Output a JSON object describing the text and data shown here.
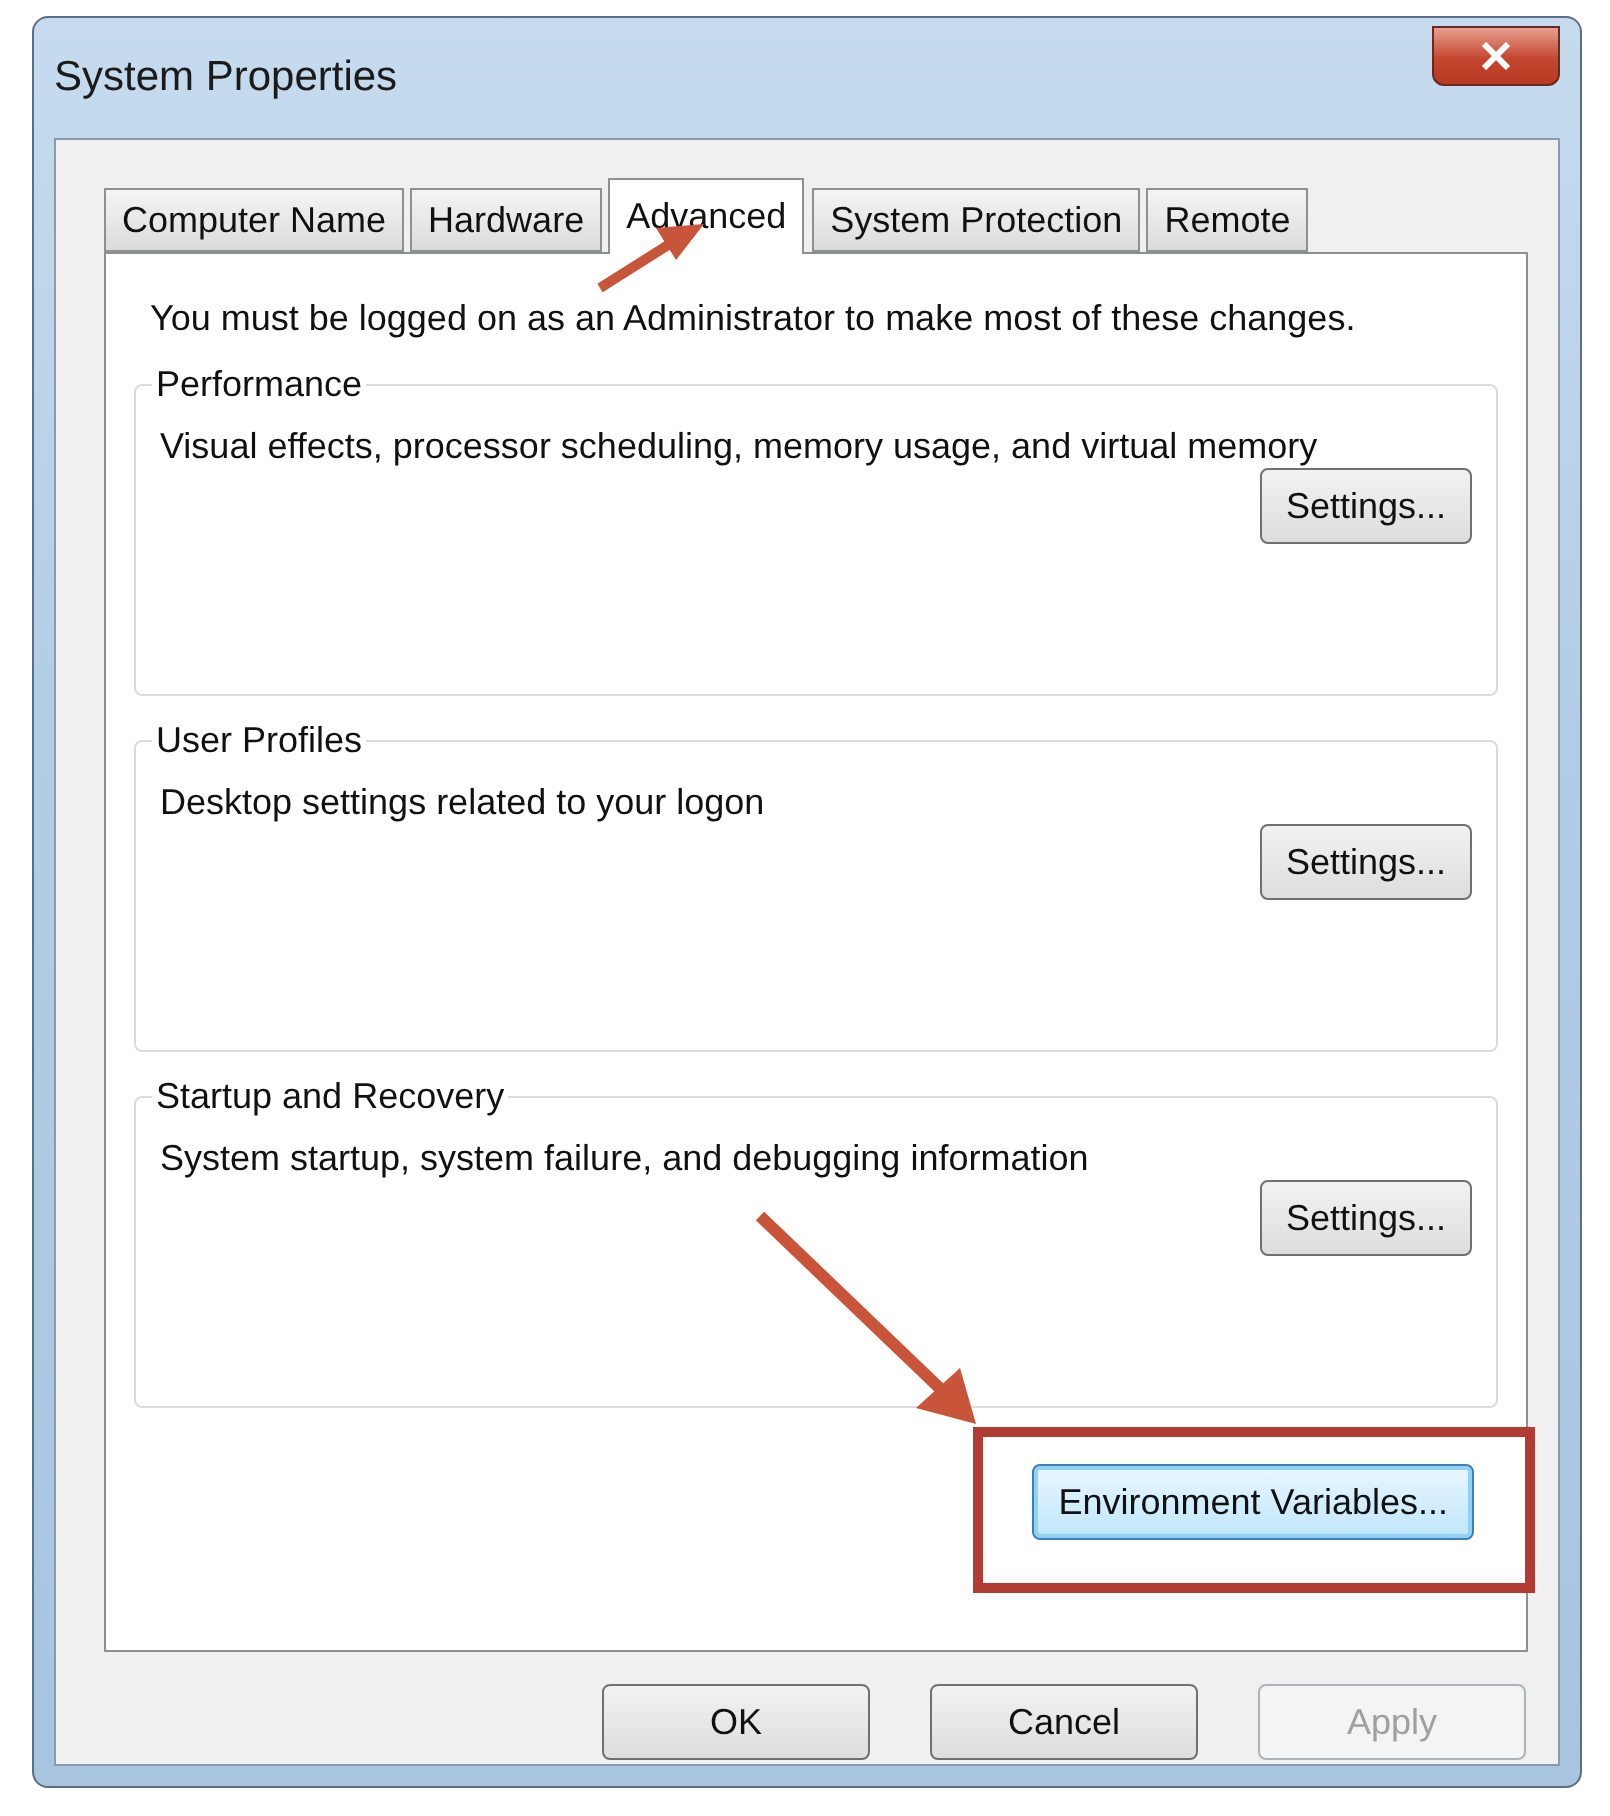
{
  "window": {
    "title": "System Properties"
  },
  "tabs": [
    {
      "label": "Computer Name",
      "selected": false
    },
    {
      "label": "Hardware",
      "selected": false
    },
    {
      "label": "Advanced",
      "selected": true
    },
    {
      "label": "System Protection",
      "selected": false
    },
    {
      "label": "Remote",
      "selected": false
    }
  ],
  "notice": "You must be logged on as an Administrator to make most of these changes.",
  "groups": [
    {
      "title": "Performance",
      "description": "Visual effects, processor scheduling, memory usage, and virtual memory",
      "button": "Settings..."
    },
    {
      "title": "User Profiles",
      "description": "Desktop settings related to your logon",
      "button": "Settings..."
    },
    {
      "title": "Startup and Recovery",
      "description": "System startup, system failure, and debugging information",
      "button": "Settings..."
    }
  ],
  "environment_button": {
    "label": "Environment Variables...",
    "focused": true
  },
  "buttons": [
    {
      "label": "OK",
      "disabled": false
    },
    {
      "label": "Cancel",
      "disabled": false
    },
    {
      "label": "Apply",
      "disabled": true
    }
  ]
}
